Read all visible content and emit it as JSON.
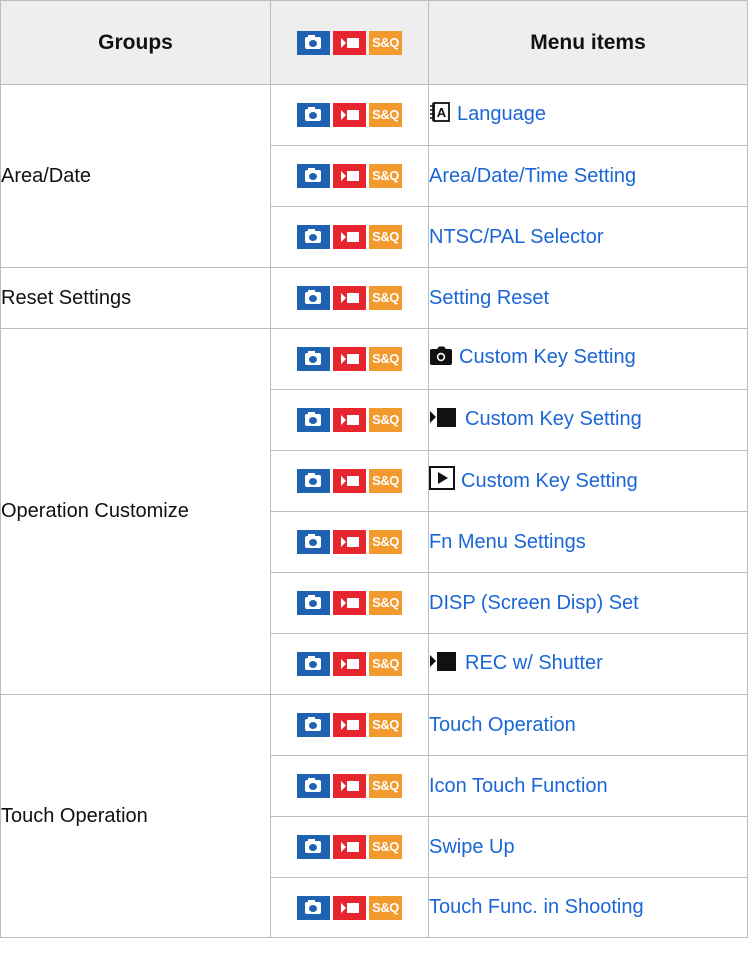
{
  "header": {
    "groups": "Groups",
    "menu_items": "Menu items",
    "mode_icons": [
      "camera-photo-icon",
      "movie-icon",
      "s-and-q-icon"
    ]
  },
  "mode_badge": {
    "sq_text": "S&Q",
    "photo_color": "#1f62b1",
    "movie_color": "#e5262f",
    "sq_color": "#f39a2f"
  },
  "link_color": "#1a66d6",
  "groups": [
    {
      "name": "Area/Date",
      "items": [
        {
          "label": "Language",
          "icon": "language-icon"
        },
        {
          "label": "Area/Date/Time Setting",
          "icon": ""
        },
        {
          "label": "NTSC/PAL Selector",
          "icon": ""
        }
      ]
    },
    {
      "name": "Reset Settings",
      "items": [
        {
          "label": "Setting Reset",
          "icon": ""
        }
      ]
    },
    {
      "name": "Operation Customize",
      "items": [
        {
          "label": "Custom Key Setting",
          "icon": "still-camera-icon"
        },
        {
          "label": "Custom Key Setting",
          "icon": "movie-mode-icon"
        },
        {
          "label": "Custom Key Setting",
          "icon": "playback-icon"
        },
        {
          "label": "Fn Menu Settings",
          "icon": ""
        },
        {
          "label": "DISP (Screen Disp) Set",
          "icon": ""
        },
        {
          "label": "REC w/ Shutter",
          "icon": "movie-mode-icon"
        }
      ]
    },
    {
      "name": "Touch Operation",
      "items": [
        {
          "label": "Touch Operation",
          "icon": ""
        },
        {
          "label": "Icon Touch Function",
          "icon": ""
        },
        {
          "label": "Swipe Up",
          "icon": ""
        },
        {
          "label": "Touch Func. in Shooting",
          "icon": ""
        }
      ]
    }
  ]
}
